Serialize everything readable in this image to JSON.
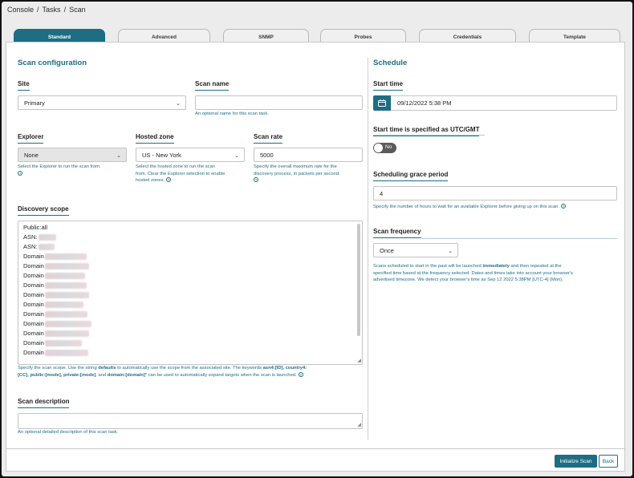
{
  "breadcrumb": [
    "Console",
    "Tasks",
    "Scan"
  ],
  "tabs": [
    "Standard",
    "Advanced",
    "SNMP",
    "Probes",
    "Credentials",
    "Template"
  ],
  "left": {
    "section_title": "Scan configuration",
    "site": {
      "label": "Site",
      "value": "Primary"
    },
    "scan_name": {
      "label": "Scan name",
      "value": "",
      "hint": "An optional name for this scan task."
    },
    "explorer": {
      "label": "Explorer",
      "value": "None",
      "hint": "Select the Explorer to run the scan from."
    },
    "hosted_zone": {
      "label": "Hosted zone",
      "value": "US - New York",
      "hint1": "Select the hosted zone to run the scan",
      "hint2": "from. Clear the Explorer selection to enable",
      "hint3": "hosted zones."
    },
    "scan_rate": {
      "label": "Scan rate",
      "value": "5000",
      "hint1": "Specify the overall maximum rate for the",
      "hint2": "discovery process, in packets per second."
    },
    "discovery_scope": {
      "label": "Discovery scope",
      "lines": [
        "Public:all",
        "ASN:",
        "ASN:",
        "Domain",
        "Domain",
        "Domain",
        "Domain",
        "Domain",
        "Domain",
        "Domain",
        "Domain",
        "Domain",
        "Domain",
        "Domain"
      ],
      "help1_a": "Specify the scan scope. Use the string ",
      "help1_b": "defaults",
      "help1_c": " to automatically use the scope from the associated site. The keywords ",
      "help1_d": "asn4:[ID], country4:",
      "help2_a": "[CC], public:[mode], private:[mode]",
      "help2_b": ", and ",
      "help2_c": "domain:[domain]",
      "help2_d": "* can be used to automatically expand targets when the scan is launched."
    },
    "scan_description": {
      "label": "Scan description",
      "value": "",
      "hint": "An optional detailed description of this scan task."
    }
  },
  "right": {
    "section_title": "Schedule",
    "start_time": {
      "label": "Start time",
      "value": "09/12/2022 5:38 PM"
    },
    "utc": {
      "label": "Start time is specified as UTC/GMT",
      "toggle": "No"
    },
    "grace": {
      "label": "Scheduling grace period",
      "value": "4",
      "hint": "Specify the number of hours to wait for an available Explorer before giving up on this scan."
    },
    "frequency": {
      "label": "Scan frequency",
      "value": "Once",
      "help1_a": "Scans scheduled to start in the past will be launched ",
      "help1_b": "immediately",
      "help1_c": " and then repeated at the",
      "help2": "specified time based at the frequency selected. Dates and times take into account your browser's",
      "help3": "advertised timezone. We detect your browser's time as Sep 12 2022 5:38PM [UTC-4] (Mon)."
    }
  },
  "footer": {
    "initialize": "Initialize Scan",
    "back": "Back"
  },
  "colors": {
    "accent": "#1d6d83",
    "background": "#ececec"
  }
}
